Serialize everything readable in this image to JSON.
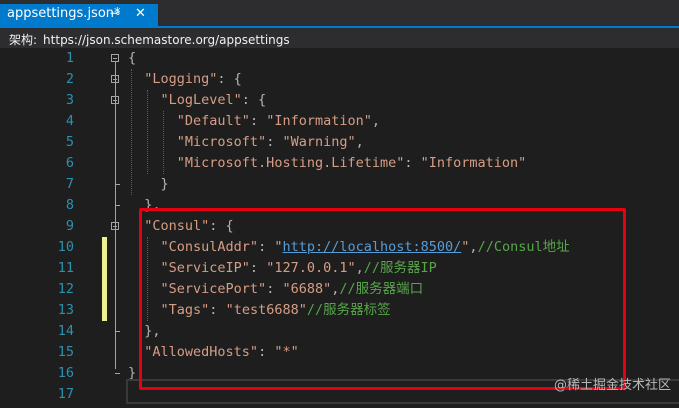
{
  "tab": {
    "title": "appsettings.json*",
    "pin_icon": "pin-icon",
    "close_icon": "close-icon"
  },
  "schema_bar": {
    "label": "架构:",
    "url": "https://json.schemastore.org/appsettings"
  },
  "editor": {
    "line_numbers": [
      "1",
      "2",
      "3",
      "4",
      "5",
      "6",
      "7",
      "8",
      "9",
      "10",
      "11",
      "12",
      "13",
      "14",
      "15",
      "16",
      "17"
    ],
    "lines": [
      {
        "n": "1",
        "text": "{"
      },
      {
        "n": "2",
        "text": "\"Logging\": {"
      },
      {
        "n": "3",
        "text": "\"LogLevel\": {"
      },
      {
        "n": "4",
        "text": "\"Default\": \"Information\","
      },
      {
        "n": "5",
        "text": "\"Microsoft\": \"Warning\","
      },
      {
        "n": "6",
        "text": "\"Microsoft.Hosting.Lifetime\": \"Information\""
      },
      {
        "n": "7",
        "text": "}"
      },
      {
        "n": "8",
        "text": "},"
      },
      {
        "n": "9",
        "text": "\"Consul\": {"
      },
      {
        "n": "10",
        "text": "\"ConsulAddr\": \"http://localhost:8500/\",//Consul地址"
      },
      {
        "n": "11",
        "text": "\"ServiceIP\": \"127.0.0.1\",//服务器IP"
      },
      {
        "n": "12",
        "text": "\"ServicePort\": \"6688\",//服务器端口"
      },
      {
        "n": "13",
        "text": "\"Tags\": \"test6688\"//服务器标签"
      },
      {
        "n": "14",
        "text": "},"
      },
      {
        "n": "15",
        "text": "\"AllowedHosts\": \"*\""
      },
      {
        "n": "16",
        "text": "}"
      },
      {
        "n": "17",
        "text": ""
      }
    ]
  },
  "watermark": "@稀土掘金技术社区",
  "colors": {
    "tab_active": "#007acc",
    "background": "#1e1e1e",
    "line_number": "#2b91af",
    "string": "#d69d85",
    "comment": "#57a64a",
    "url": "#569cd6",
    "highlight_box": "#e60012",
    "change_marker": "#efef91"
  }
}
